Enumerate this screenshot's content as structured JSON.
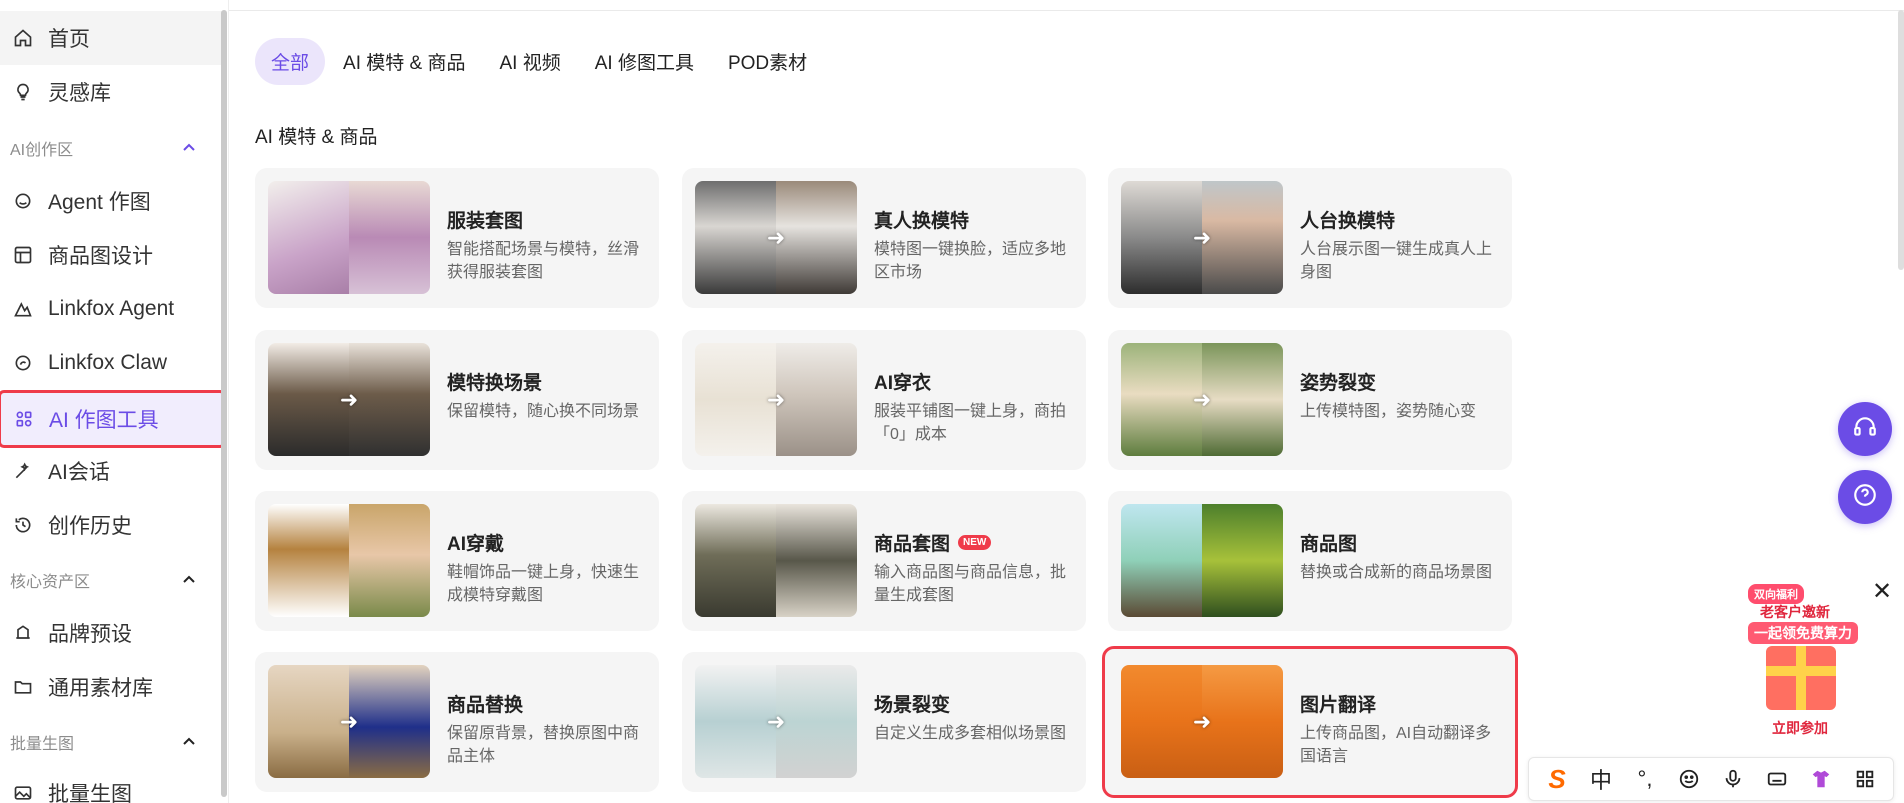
{
  "sidebar": {
    "items": [
      {
        "label": "首页",
        "icon": "home-icon"
      },
      {
        "label": "灵感库",
        "icon": "lightbulb-icon"
      }
    ],
    "sections": [
      {
        "label": "AI创作区",
        "items": [
          {
            "label": "Agent 作图",
            "icon": "agent-icon"
          },
          {
            "label": "商品图设计",
            "icon": "layout-icon"
          },
          {
            "label": "Linkfox Agent",
            "icon": "linkfox-agent-icon"
          },
          {
            "label": "Linkfox Claw",
            "icon": "claw-icon"
          },
          {
            "label": "AI 作图工具",
            "icon": "tools-grid-icon"
          },
          {
            "label": "AI会话",
            "icon": "magic-wand-icon"
          },
          {
            "label": "创作历史",
            "icon": "history-icon"
          }
        ]
      },
      {
        "label": "核心资产区",
        "items": [
          {
            "label": "品牌预设",
            "icon": "brand-icon"
          },
          {
            "label": "通用素材库",
            "icon": "folder-icon"
          }
        ]
      },
      {
        "label": "批量生图",
        "items": [
          {
            "label": "批量生图",
            "icon": "image-icon"
          }
        ]
      }
    ]
  },
  "tabs": [
    "全部",
    "AI 模特 & 商品",
    "AI 视频",
    "AI 修图工具",
    "POD素材"
  ],
  "active_tab": "全部",
  "section_title": "AI 模特 & 商品",
  "cards": [
    {
      "title": "服装套图",
      "desc": "智能搭配场景与模特，丝滑获得服装套图"
    },
    {
      "title": "真人换模特",
      "desc": "模特图一键换脸，适应多地区市场"
    },
    {
      "title": "人台换模特",
      "desc": "人台展示图一键生成真人上身图"
    },
    {
      "title": "模特换场景",
      "desc": "保留模特，随心换不同场景"
    },
    {
      "title": "AI穿衣",
      "desc": "服装平铺图一键上身，商拍「0」成本"
    },
    {
      "title": "姿势裂变",
      "desc": "上传模特图，姿势随心变"
    },
    {
      "title": "AI穿戴",
      "desc": "鞋帽饰品一键上身，快速生成模特穿戴图"
    },
    {
      "title": "商品套图",
      "desc": "输入商品图与商品信息，批量生成套图",
      "badge": "NEW"
    },
    {
      "title": "商品图",
      "desc": "替换或合成新的商品场景图"
    },
    {
      "title": "商品替换",
      "desc": "保留原背景，替换原图中商品主体"
    },
    {
      "title": "场景裂变",
      "desc": "自定义生成多套相似场景图"
    },
    {
      "title": "图片翻译",
      "desc": "上传商品图，AI自动翻译多国语言"
    }
  ],
  "float_buttons": [
    "headset-icon",
    "help-icon"
  ],
  "promo": {
    "tag": "双向福利",
    "line1": "老客户邀新",
    "line2": "一起领免费算力",
    "button": "立即参加"
  },
  "ime": {
    "logo": "S",
    "lang": "中",
    "punct": "°,",
    "items": [
      "emoji-icon",
      "microphone-icon",
      "keyboard-icon",
      "shirt-icon",
      "grid-icon"
    ]
  },
  "colors": {
    "accent": "#6b4ce6",
    "highlight_border": "#ef3b4a"
  }
}
